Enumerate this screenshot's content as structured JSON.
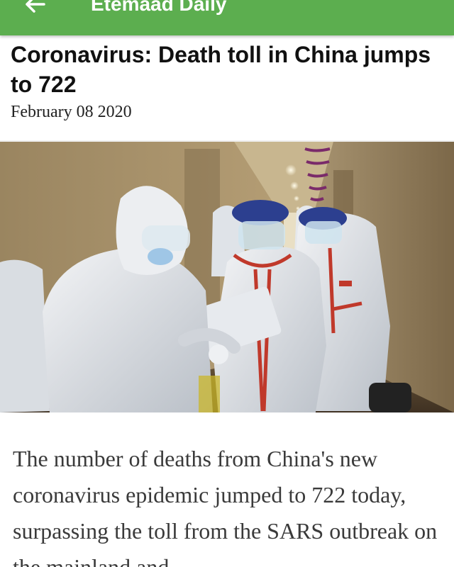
{
  "appbar": {
    "title": "Etemaad Daily",
    "back_icon": "arrow-back-icon",
    "color": "#5cae4f"
  },
  "article": {
    "headline": "Coronavirus: Death toll in China jumps to 722",
    "date": "February 08 2020",
    "body": "The number of deaths from China's new coronavirus epidemic jumped to 722 today, surpassing the toll from the SARS outbreak on the mainland and"
  }
}
